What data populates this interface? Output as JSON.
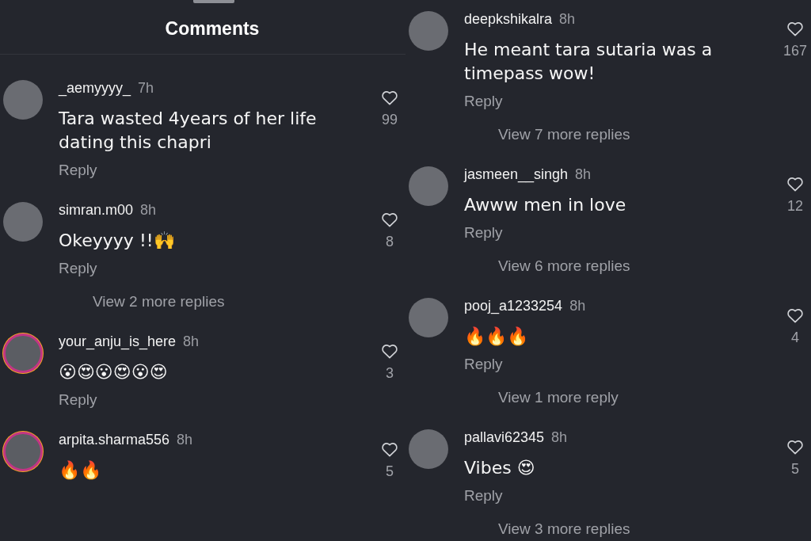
{
  "panels": [
    {
      "header": "Comments",
      "comments": [
        {
          "user": "_aemyyyy_",
          "time": "7h",
          "text": "Tara wasted 4years of her life dating this chapri",
          "likes": "99",
          "reply": "Reply",
          "story_ring": false
        },
        {
          "user": "simran.m00",
          "time": "8h",
          "text": "Okeyyyy !!🙌",
          "likes": "8",
          "reply": "Reply",
          "story_ring": false,
          "more_replies": "View 2 more replies"
        },
        {
          "user": "your_anju_is_here",
          "time": "8h",
          "text": "😮😍😮😍😮😍",
          "likes": "3",
          "reply": "Reply",
          "story_ring": true
        },
        {
          "user": "arpita.sharma556",
          "time": "8h",
          "text": "🔥🔥",
          "likes": "5",
          "story_ring": true
        }
      ]
    },
    {
      "comments": [
        {
          "user": "deepkshikalra",
          "time": "8h",
          "text": "He meant tara sutaria was a timepass wow!",
          "likes": "167",
          "reply": "Reply",
          "story_ring": false,
          "more_replies": "View 7 more replies"
        },
        {
          "user": "jasmeen__singh",
          "time": "8h",
          "text": "Awww men in love",
          "likes": "12",
          "reply": "Reply",
          "story_ring": false,
          "more_replies": "View 6 more replies"
        },
        {
          "user": "pooj_a1233254",
          "time": "8h",
          "text": "🔥🔥🔥",
          "likes": "4",
          "reply": "Reply",
          "story_ring": false,
          "more_replies": "View 1 more reply"
        },
        {
          "user": "pallavi62345",
          "time": "8h",
          "text": "Vibes 😍",
          "likes": "5",
          "reply": "Reply",
          "story_ring": false,
          "more_replies": "View 3 more replies"
        }
      ]
    }
  ]
}
